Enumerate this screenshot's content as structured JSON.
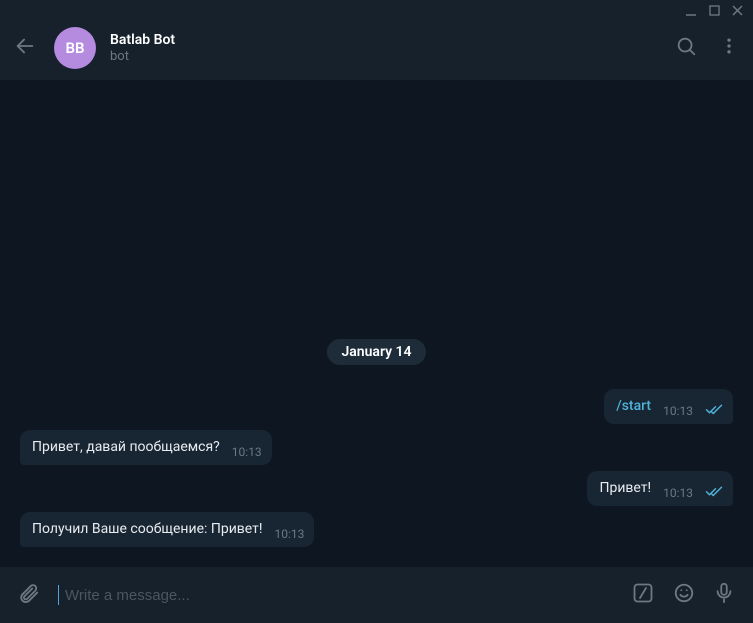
{
  "header": {
    "avatar_initials": "BB",
    "title": "Batlab Bot",
    "subtitle": "bot"
  },
  "date_separator": "January 14",
  "messages": [
    {
      "dir": "out",
      "text": "/start",
      "is_command": true,
      "time": "10:13",
      "ticks": true
    },
    {
      "dir": "in",
      "text": "Привет, давай пообщаемся?",
      "is_command": false,
      "time": "10:13",
      "ticks": false
    },
    {
      "dir": "out",
      "text": "Привет!",
      "is_command": false,
      "time": "10:13",
      "ticks": true
    },
    {
      "dir": "in",
      "text": "Получил Ваше сообщение: Привет!",
      "is_command": false,
      "time": "10:13",
      "ticks": false
    }
  ],
  "input": {
    "placeholder": "Write a message...",
    "value": ""
  }
}
